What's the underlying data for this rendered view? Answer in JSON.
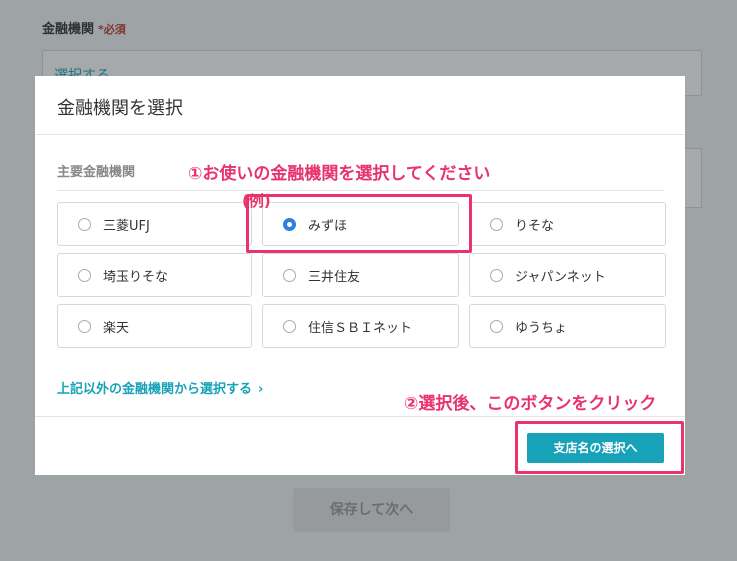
{
  "background": {
    "field_label": "金融機関",
    "required_mark": "*必須",
    "select_placeholder": "選択する",
    "save_button": "保存して次へ"
  },
  "modal": {
    "title": "金融機関を選択",
    "section_label": "主要金融機関",
    "banks": [
      {
        "label": "三菱UFJ",
        "selected": false
      },
      {
        "label": "みずほ",
        "selected": true
      },
      {
        "label": "りそな",
        "selected": false
      },
      {
        "label": "埼玉りそな",
        "selected": false
      },
      {
        "label": "三井住友",
        "selected": false
      },
      {
        "label": "ジャパンネット",
        "selected": false
      },
      {
        "label": "楽天",
        "selected": false
      },
      {
        "label": "住信ＳＢＩネット",
        "selected": false
      },
      {
        "label": "ゆうちょ",
        "selected": false
      }
    ],
    "other_link": "上記以外の金融機関から選択する",
    "other_link_chevron": "›",
    "next_button": "支店名の選択へ"
  },
  "annotations": {
    "step1": "①お使いの金融機関を選択してください",
    "example": "(例)",
    "step2": "②選択後、このボタンをクリック"
  },
  "colors": {
    "accent": "#17a2b8",
    "annotation": "#e8336d",
    "radio_selected": "#2d7fe0"
  }
}
